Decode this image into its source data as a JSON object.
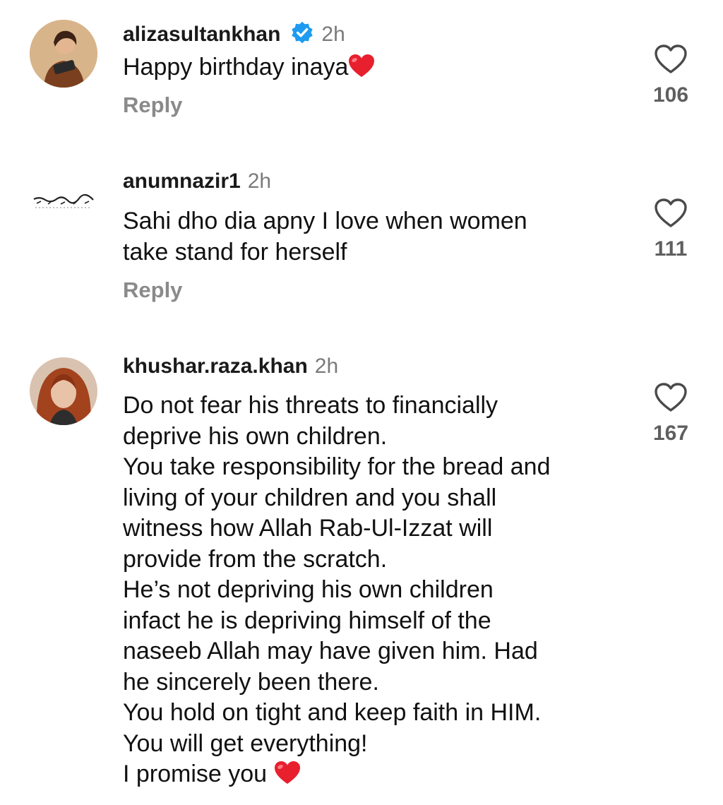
{
  "comments": [
    {
      "username": "alizasultankhan",
      "verified": true,
      "time": "2h",
      "lines": [
        "Happy birthday inaya"
      ],
      "trailing_emoji": "red-heart",
      "reply_label": "Reply",
      "like_count": "106"
    },
    {
      "username": "anumnazir1",
      "verified": false,
      "time": "2h",
      "lines": [
        "Sahi dho dia apny I love when women",
        "take stand for herself"
      ],
      "reply_label": "Reply",
      "like_count": "111"
    },
    {
      "username": "khushar.raza.khan",
      "verified": false,
      "time": "2h",
      "lines": [
        "Do not fear his threats to financially",
        "deprive his own children.",
        "You take responsibility for the bread and",
        "living of your children and you shall",
        "witness how Allah Rab-Ul-Izzat will",
        "provide from the scratch.",
        "He’s not depriving his own children",
        "infact he is depriving himself of the",
        "naseeb Allah may have given him. Had",
        "he sincerely been there.",
        "You hold on tight and keep faith in HIM.",
        "You will get everything!",
        "I promise you "
      ],
      "trailing_emoji": "red-heart",
      "like_count": "167"
    }
  ],
  "colors": {
    "verified_badge": "#1d9bf0",
    "heart_emoji": "#e8202e",
    "muted_text": "#8a8a8a"
  },
  "icons": {
    "like": "heart-outline-icon",
    "verified": "verified-badge-icon",
    "emoji": "red-heart-emoji"
  }
}
